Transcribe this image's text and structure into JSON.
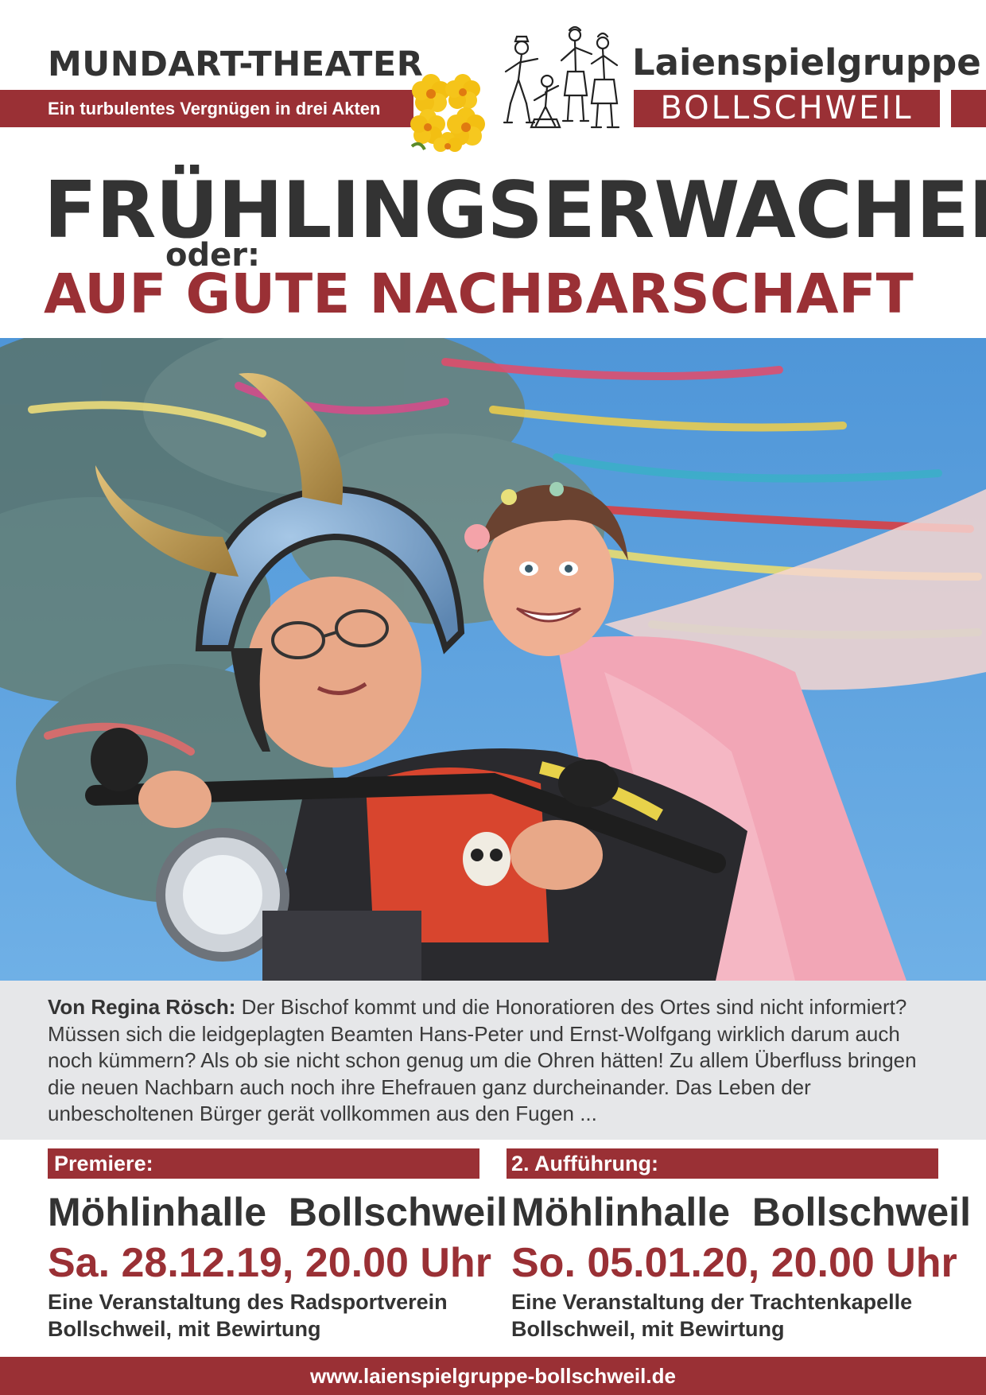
{
  "header": {
    "left_title": "MUNDART-THEATER",
    "tagline": "Ein turbulentes Vergnügen in drei Akten",
    "brand_name": "Laienspielgruppe",
    "brand_place": "BOLLSCHWEIL"
  },
  "titles": {
    "main": "FRÜHLINGSERWACHEN",
    "connector": "oder:",
    "sub": "AUF GUTE NACHBARSCHAFT"
  },
  "description": {
    "author_label": "Von Regina Rösch:",
    "text": " Der Bischof kommt und die Honoratioren des Ortes sind nicht informiert? Müssen sich die leidgeplagten Beamten Hans-Peter und Ernst-Wolfgang wirklich darum auch noch kümmern? Als ob sie nicht schon genug um die Ohren hätten! Zu allem Überfluss bringen die neuen Nachbarn auch noch ihre Ehefrauen ganz durcheinander. Das Leben der unbescholtenen Bürger gerät vollkommen aus den Fugen ..."
  },
  "performances": [
    {
      "label": "Premiere:",
      "venue": "Möhlinhalle Bollschweil",
      "date": "Sa. 28.12.19, 20.00 Uhr",
      "organizer": "Eine Veranstaltung des Radsportverein Bollschweil, mit Bewirtung"
    },
    {
      "label": "2. Aufführung:",
      "venue": "Möhlinhalle Bollschweil",
      "date": "So. 05.01.20, 20.00 Uhr",
      "organizer": "Eine Veranstaltung der Trachtenkapelle Bollschweil, mit Bewirtung"
    }
  ],
  "footer": {
    "url": "www.laienspielgruppe-bollschweil.de"
  },
  "icons": {
    "flowers": "primrose-flowers-icon",
    "logo": "actors-sketch-logo"
  },
  "colors": {
    "accent": "#9a3035",
    "text": "#333333",
    "desc_bg": "#e6e7e9"
  }
}
